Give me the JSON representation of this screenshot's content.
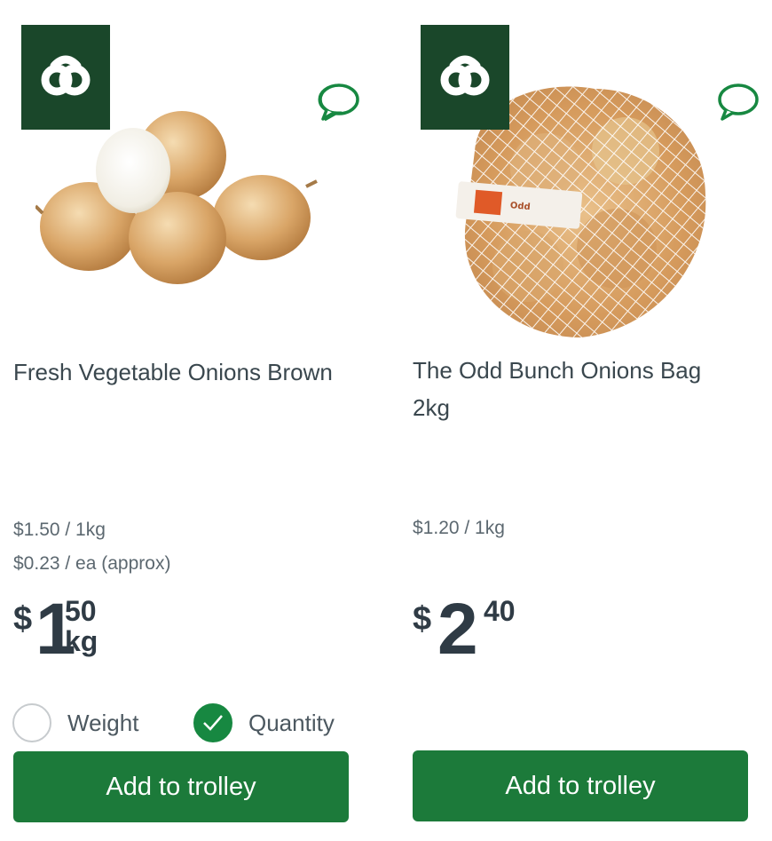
{
  "colors": {
    "brand_dark": "#1a472a",
    "button_green": "#1c7a3a",
    "check_green": "#178841",
    "text": "#3a474e"
  },
  "products": [
    {
      "name": "Fresh Vegetable Onions Brown",
      "unit_price_1": "$1.50 / 1kg",
      "unit_price_2": "$0.23 / ea (approx)",
      "price": {
        "dollar": "$",
        "whole": "1",
        "cents": "50",
        "per": "kg"
      },
      "options": {
        "weight_label": "Weight",
        "quantity_label": "Quantity",
        "selected": "Quantity"
      },
      "button_label": "Add to trolley",
      "badge_icon": "woolworths-logo-icon",
      "review_icon": "speech-bubble-icon"
    },
    {
      "name": "The Odd Bunch Onions Bag 2kg",
      "unit_price_1": "$1.20 / 1kg",
      "price": {
        "dollar": "$",
        "whole": "2",
        "cents": "40"
      },
      "button_label": "Add to trolley",
      "badge_icon": "woolworths-logo-icon",
      "review_icon": "speech-bubble-icon"
    }
  ]
}
